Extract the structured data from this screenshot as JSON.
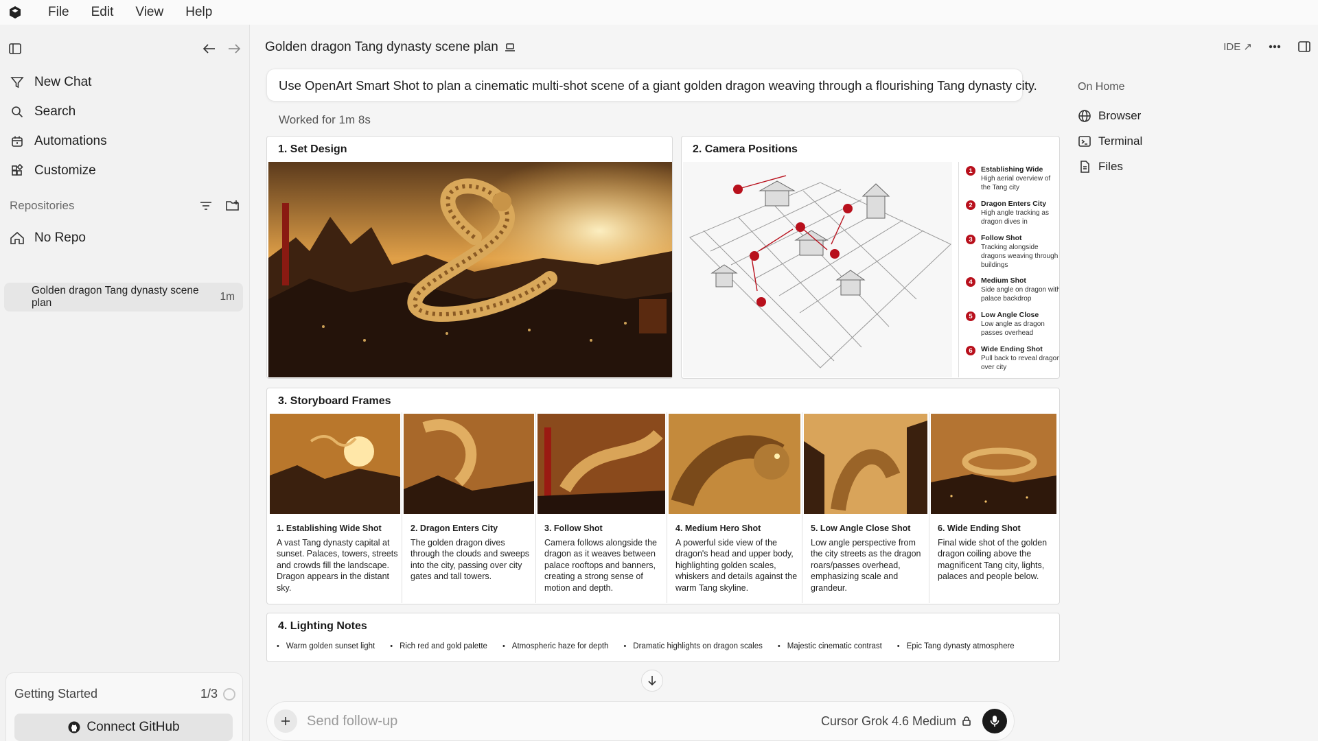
{
  "menubar": {
    "items": [
      "File",
      "Edit",
      "View",
      "Help"
    ]
  },
  "sidebar": {
    "nav": [
      {
        "label": "New Chat",
        "icon": "filter-funnel-icon"
      },
      {
        "label": "Search",
        "icon": "search-icon"
      },
      {
        "label": "Automations",
        "icon": "calendar-clock-icon"
      },
      {
        "label": "Customize",
        "icon": "blocks-icon"
      }
    ],
    "repos_label": "Repositories",
    "no_repo": "No Repo",
    "thread": {
      "title": "Golden dragon Tang dynasty scene plan",
      "age": "1m"
    },
    "getting_started": {
      "label": "Getting Started",
      "progress": "1/3"
    },
    "connect_github": "Connect GitHub"
  },
  "header": {
    "title": "Golden dragon Tang dynasty scene plan",
    "ide_label": "IDE ↗"
  },
  "chat": {
    "prompt": "Use OpenArt Smart Shot to plan a cinematic multi-shot scene of a giant golden dragon weaving through a flourishing Tang dynasty city.",
    "worked_for": "Worked for 1m 8s"
  },
  "panels": {
    "set_design": {
      "title": "1. Set Design"
    },
    "camera": {
      "title": "2. Camera Positions",
      "items": [
        {
          "num": "1",
          "title": "Establishing Wide",
          "desc": "High aerial overview of the Tang city"
        },
        {
          "num": "2",
          "title": "Dragon Enters City",
          "desc": "High angle tracking as dragon dives in"
        },
        {
          "num": "3",
          "title": "Follow Shot",
          "desc": "Tracking alongside dragons weaving through buildings"
        },
        {
          "num": "4",
          "title": "Medium Shot",
          "desc": "Side angle on dragon with palace backdrop"
        },
        {
          "num": "5",
          "title": "Low Angle Close",
          "desc": "Low angle as dragon passes overhead"
        },
        {
          "num": "6",
          "title": "Wide Ending Shot",
          "desc": "Pull back to reveal dragon over city"
        }
      ]
    },
    "storyboard": {
      "title": "3. Storyboard Frames",
      "frames": [
        {
          "title": "1. Establishing Wide Shot",
          "desc": "A vast Tang dynasty capital at sunset. Palaces, towers, streets and crowds fill the landscape. Dragon appears in the distant sky."
        },
        {
          "title": "2. Dragon Enters City",
          "desc": "The golden dragon dives through the clouds and sweeps into the city, passing over city gates and tall towers."
        },
        {
          "title": "3. Follow Shot",
          "desc": "Camera follows alongside the dragon as it weaves between palace rooftops and banners, creating a strong sense of motion and depth."
        },
        {
          "title": "4. Medium Hero Shot",
          "desc": "A powerful side view of the dragon's head and upper body, highlighting golden scales, whiskers and details against the warm Tang skyline."
        },
        {
          "title": "5. Low Angle Close Shot",
          "desc": "Low angle perspective from the city streets as the dragon roars/passes overhead, emphasizing scale and grandeur."
        },
        {
          "title": "6. Wide Ending Shot",
          "desc": "Final wide shot of the golden dragon coiling above the magnificent Tang city, lights, palaces and people below."
        }
      ]
    },
    "lighting": {
      "title": "4. Lighting Notes",
      "items": [
        "Warm golden sunset light",
        "Rich red and gold palette",
        "Atmospheric haze for depth",
        "Dramatic highlights on dragon scales",
        "Majestic cinematic contrast",
        "Epic Tang dynasty atmosphere"
      ]
    }
  },
  "composer": {
    "placeholder": "Send follow-up",
    "model": "Cursor Grok 4.6 Medium"
  },
  "right_panel": {
    "heading": "On Home",
    "items": [
      {
        "label": "Browser",
        "icon": "globe-icon"
      },
      {
        "label": "Terminal",
        "icon": "terminal-icon"
      },
      {
        "label": "Files",
        "icon": "file-icon"
      }
    ]
  },
  "colors": {
    "marker_red": "#b8101c",
    "gold": "#e8a33a"
  }
}
